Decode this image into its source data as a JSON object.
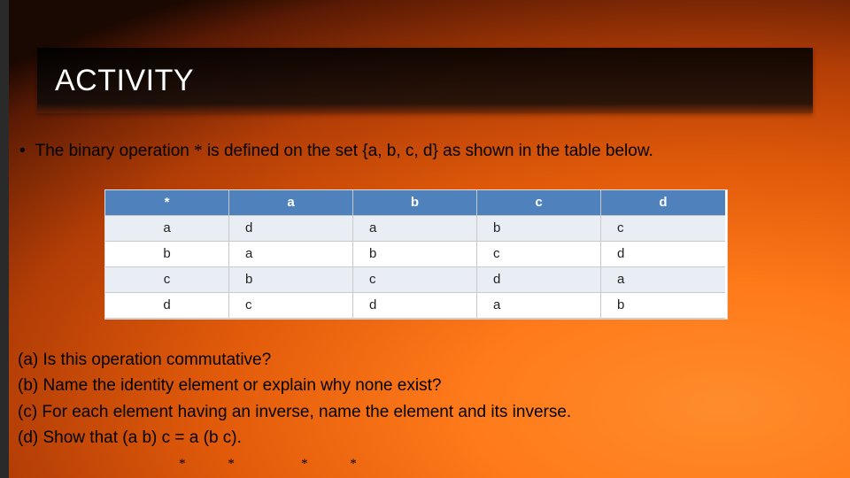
{
  "title": "ACTIVITY",
  "bullet": {
    "dot": "•",
    "prefix": "The binary operation ",
    "star": "*",
    "suffix": "is defined on the set {a, b, c, d} as shown in the table below."
  },
  "table": {
    "header": [
      "*",
      "a",
      "b",
      "c",
      "d"
    ],
    "rows": [
      {
        "label": "a",
        "cells": [
          "d",
          "a",
          "b",
          "c"
        ]
      },
      {
        "label": "b",
        "cells": [
          "a",
          "b",
          "c",
          "d"
        ]
      },
      {
        "label": "c",
        "cells": [
          "b",
          "c",
          "d",
          "a"
        ]
      },
      {
        "label": "d",
        "cells": [
          "c",
          "d",
          "a",
          "b"
        ]
      }
    ]
  },
  "questions": {
    "a": "(a) Is this operation commutative?",
    "b": "(b) Name the identity element or explain why none exist?",
    "c": "(c) For each element having an inverse, name the element and its inverse.",
    "d": "(d)  Show that (a   b)    c = a   (b    c)."
  },
  "substars1": "*  *",
  "substars2": "*  *",
  "chart_data": {
    "type": "table",
    "title": "Cayley table for binary operation * on {a,b,c,d}",
    "columns": [
      "*",
      "a",
      "b",
      "c",
      "d"
    ],
    "rows": [
      [
        "a",
        "d",
        "a",
        "b",
        "c"
      ],
      [
        "b",
        "a",
        "b",
        "c",
        "d"
      ],
      [
        "c",
        "b",
        "c",
        "d",
        "a"
      ],
      [
        "d",
        "c",
        "d",
        "a",
        "b"
      ]
    ]
  }
}
